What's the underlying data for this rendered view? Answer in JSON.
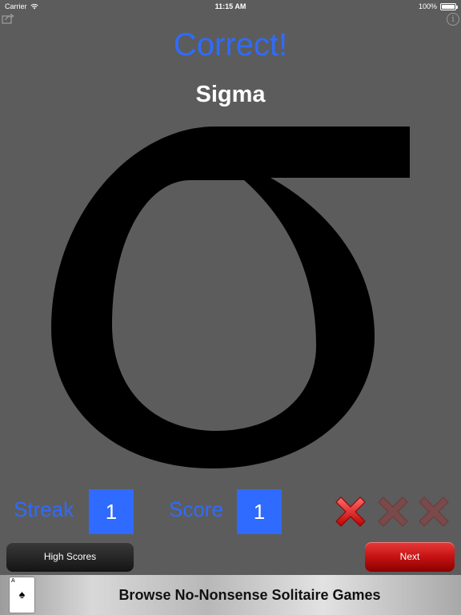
{
  "status_bar": {
    "carrier": "Carrier",
    "time": "11:15 AM",
    "battery": "100%"
  },
  "toolbar": {
    "share_icon": "share-icon",
    "info_icon": "info-icon",
    "info_glyph": "i"
  },
  "quiz": {
    "result": "Correct!",
    "letter_name": "Sigma",
    "symbol": "σ"
  },
  "stats": {
    "streak_label": "Streak",
    "streak_value": "1",
    "score_label": "Score",
    "score_value": "1"
  },
  "lives": {
    "total": 3,
    "active": 1,
    "icon": "x-mark-icon"
  },
  "buttons": {
    "high_scores": "High Scores",
    "next": "Next"
  },
  "ad": {
    "card_rank": "A",
    "card_suit": "♠",
    "text": "Browse No-Nonsense Solitaire Games"
  },
  "colors": {
    "background": "#5c5c5c",
    "accent": "#2f6bff",
    "next_button": "#c41212",
    "x_active": "#e02020",
    "x_inactive": "#7a4a4a"
  }
}
